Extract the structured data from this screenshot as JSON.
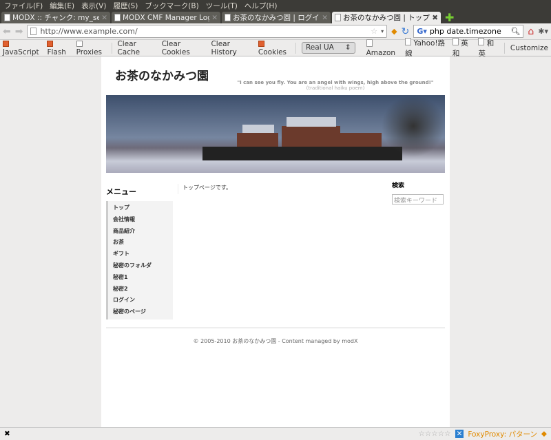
{
  "menubar": [
    "ファイル(F)",
    "編集(E)",
    "表示(V)",
    "履歴(S)",
    "ブックマーク(B)",
    "ツール(T)",
    "ヘルプ(H)"
  ],
  "tabs": [
    {
      "label": "MODX :: チャンク: my_search"
    },
    {
      "label": "MODX CMF Manager Login"
    },
    {
      "label": "お茶のなかみつ園 | ログイン"
    },
    {
      "label": "お茶のなかみつ園 | トップ",
      "active": true
    }
  ],
  "nav": {
    "url": "http://www.example.com/",
    "search_value": "php date.timezone"
  },
  "toolbar": {
    "javascript": "JavaScript",
    "flash": "Flash",
    "proxies": "Proxies",
    "clear_cache": "Clear Cache",
    "clear_cookies": "Clear Cookies",
    "clear_history": "Clear History",
    "cookies": "Cookies",
    "ua": "Real UA",
    "bookmarks": [
      "Amazon",
      "Yahoo!路線",
      "英和",
      "和英"
    ],
    "customize": "Customize"
  },
  "site": {
    "title": "お茶のなかみつ園",
    "quote": "\"I can see you fly. You are an angel with wings, high above the ground!\"",
    "quote_source": "(traditional haiku poem)",
    "menu_heading": "メニュー",
    "menu": [
      "トップ",
      "会社情報",
      "商品紹介",
      "お茶",
      "ギフト",
      "秘密のフォルダ",
      "秘密1",
      "秘密2",
      "ログイン",
      "秘密のページ"
    ],
    "main_text": "トップページです。",
    "search_heading": "検索",
    "search_placeholder": "検索キーワード",
    "footer": "© 2005-2010 お茶のなかみつ園 - Content managed by modX"
  },
  "status": {
    "foxyproxy": "FoxyProxy: パターン",
    "rating": 0
  },
  "colors": {
    "chrome_dark": "#3c3b37",
    "foxyproxy": "#e08a00"
  }
}
